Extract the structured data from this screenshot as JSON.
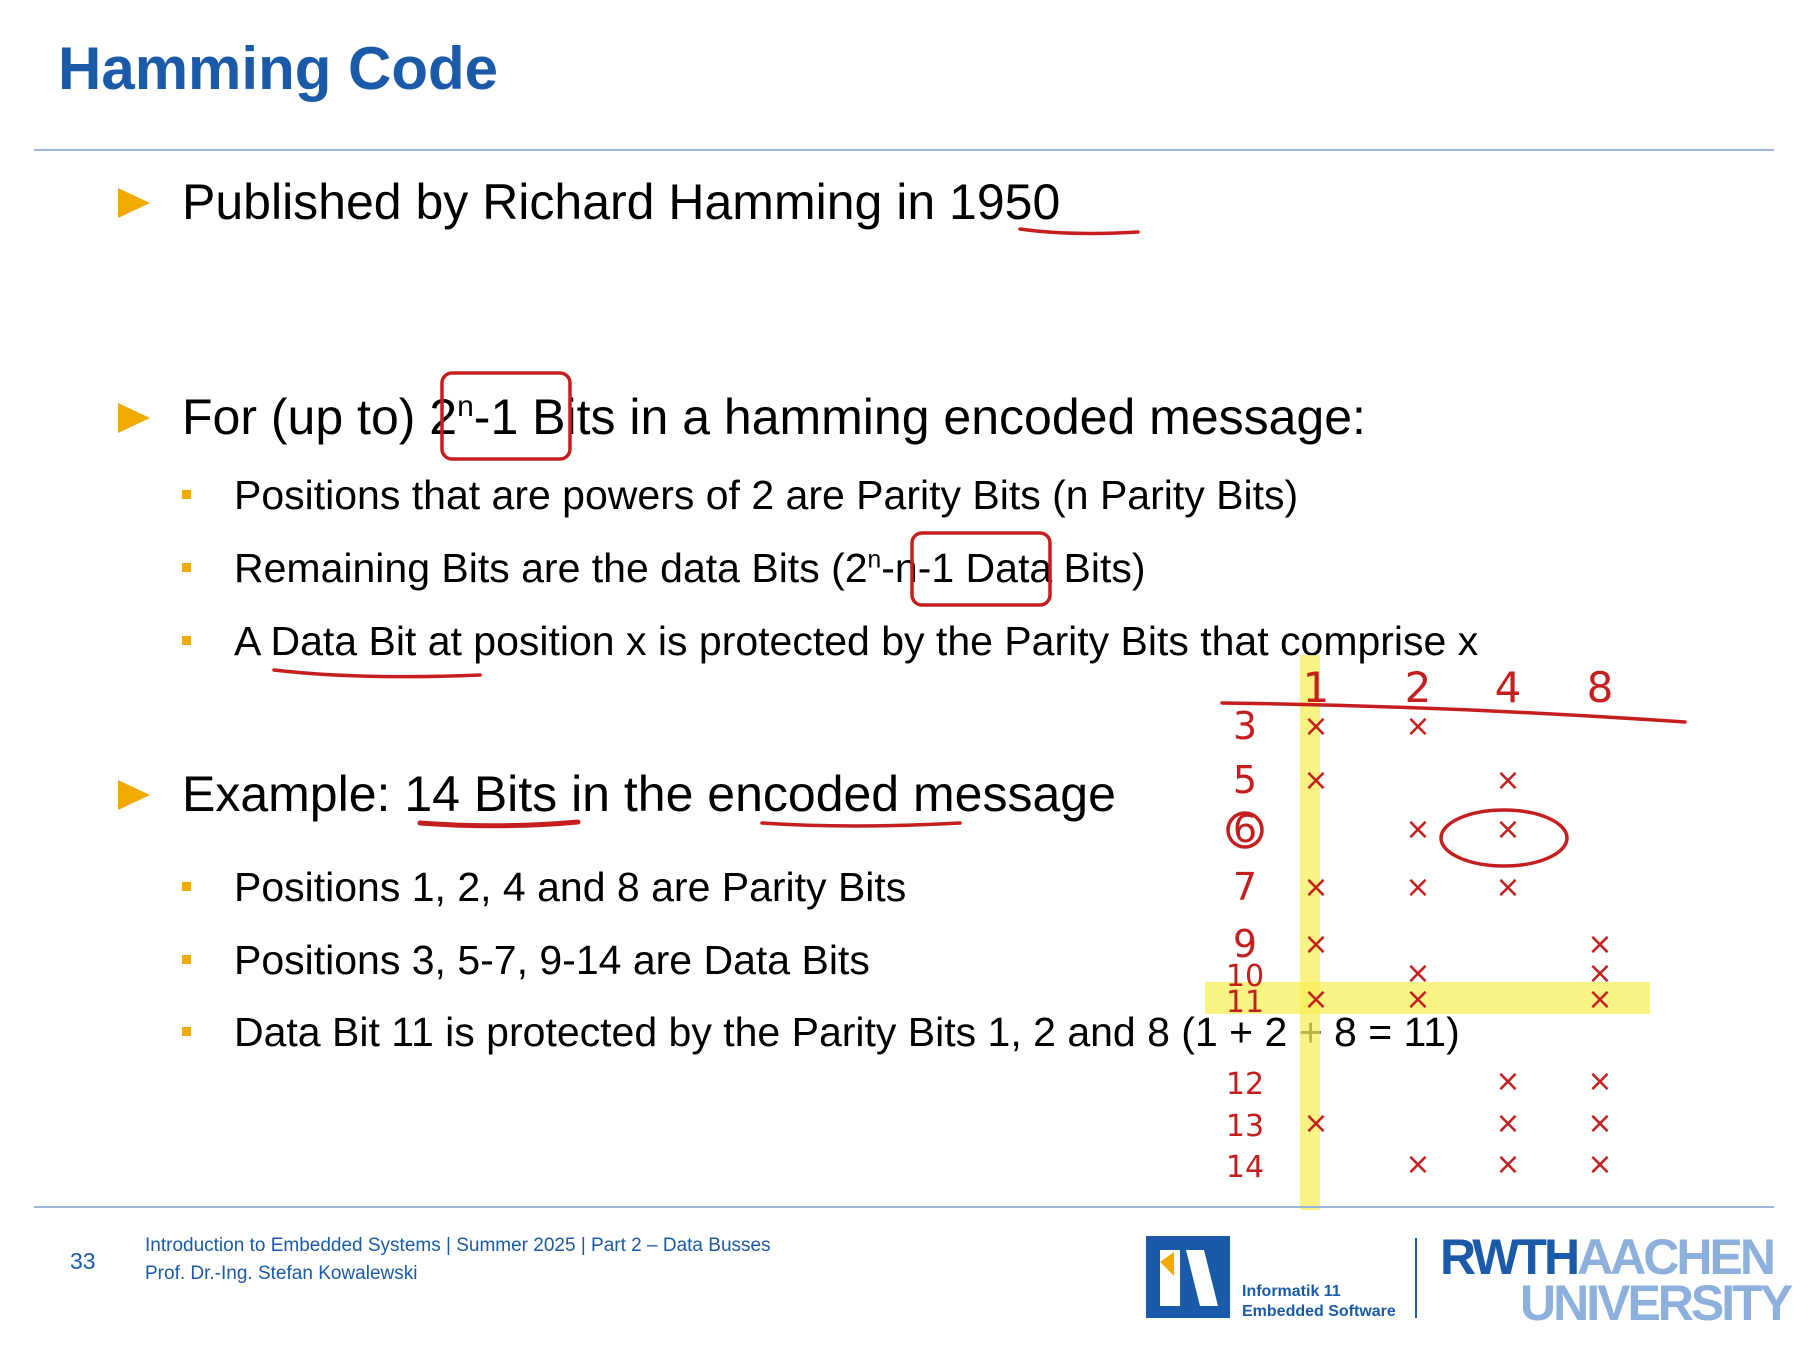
{
  "slide": {
    "title": "Hamming Code",
    "bullets": [
      {
        "text": "Published by Richard Hamming in 1950"
      },
      {
        "pre": "For (up to) 2",
        "sup": "n",
        "post": "-1 Bits in a hamming encoded message:"
      },
      {
        "text": "Example: 14 Bits in the encoded message"
      }
    ],
    "sub_bullets_1": [
      {
        "text": "Positions that are powers of 2 are Parity Bits (n Parity Bits)"
      },
      {
        "pre": "Remaining Bits are the data Bits (2",
        "sup": "n",
        "post": "-n-1 Data Bits)"
      },
      {
        "text": "A Data Bit at position x is protected by the Parity Bits that comprise x"
      }
    ],
    "sub_bullets_2": [
      {
        "text": "Positions 1, 2, 4 and 8 are Parity Bits"
      },
      {
        "text": "Positions 3, 5-7, 9-14 are Data Bits"
      },
      {
        "text": "Data Bit 11 is protected by the Parity Bits 1, 2 and 8 (1 + 2 + 8 = 11)"
      }
    ]
  },
  "annotation_table": {
    "headers": [
      "1",
      "2",
      "4",
      "8"
    ],
    "rows": [
      {
        "label": "3",
        "marks": [
          true,
          true,
          false,
          false
        ]
      },
      {
        "label": "5",
        "marks": [
          true,
          false,
          true,
          false
        ]
      },
      {
        "label": "6",
        "marks": [
          false,
          true,
          true,
          false
        ]
      },
      {
        "label": "7",
        "marks": [
          true,
          true,
          true,
          false
        ]
      },
      {
        "label": "9",
        "marks": [
          true,
          false,
          false,
          true
        ]
      },
      {
        "label": "10",
        "marks": [
          false,
          true,
          false,
          true
        ]
      },
      {
        "label": "11",
        "marks": [
          true,
          true,
          false,
          true
        ]
      },
      {
        "label": "12",
        "marks": [
          false,
          false,
          true,
          true
        ]
      },
      {
        "label": "13",
        "marks": [
          true,
          false,
          true,
          true
        ]
      },
      {
        "label": "14",
        "marks": [
          false,
          true,
          true,
          true
        ]
      }
    ],
    "mark_symbol": "×",
    "ink_color": "#c41e1e",
    "highlight_color": "#f7ef5a"
  },
  "footer": {
    "page_number": "33",
    "line1": "Introduction to Embedded Systems | Summer 2025 | Part 2 – Data Busses",
    "line2": "Prof. Dr.-Ing. Stefan Kowalewski"
  },
  "logos": {
    "institute_line1": "Informatik 11",
    "institute_line2": "Embedded Software",
    "university_part1": "RWTH",
    "university_part2": "AACHEN",
    "university_line2": "UNIVERSITY"
  },
  "colors": {
    "title": "#1b5aa8",
    "bullet_arrow": "#f2a900",
    "sub_bullet": "#f2a900",
    "rule": "#9bb6dd"
  }
}
